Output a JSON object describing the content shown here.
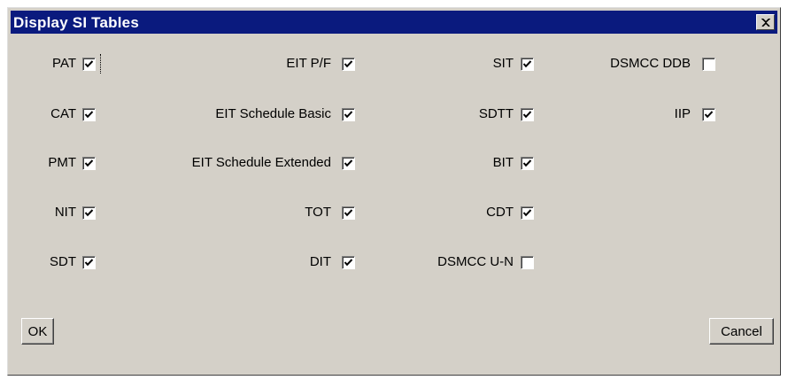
{
  "window": {
    "title": "Display SI Tables",
    "title_bg": "#0a1a7e",
    "face": "#d4d0c8"
  },
  "columns": [
    {
      "items": [
        {
          "label": "PAT",
          "checked": true
        },
        {
          "label": "CAT",
          "checked": true
        },
        {
          "label": "PMT",
          "checked": true
        },
        {
          "label": "NIT",
          "checked": true
        },
        {
          "label": "SDT",
          "checked": true
        }
      ]
    },
    {
      "items": [
        {
          "label": "EIT P/F",
          "checked": true
        },
        {
          "label": "EIT Schedule Basic",
          "checked": true
        },
        {
          "label": "EIT Schedule Extended",
          "checked": true
        },
        {
          "label": "TOT",
          "checked": true
        },
        {
          "label": "DIT",
          "checked": true
        }
      ]
    },
    {
      "items": [
        {
          "label": "SIT",
          "checked": true
        },
        {
          "label": "SDTT",
          "checked": true
        },
        {
          "label": "BIT",
          "checked": true
        },
        {
          "label": "CDT",
          "checked": true
        },
        {
          "label": "DSMCC U-N",
          "checked": false
        }
      ]
    },
    {
      "items": [
        {
          "label": "DSMCC DDB",
          "checked": false
        },
        {
          "label": "IIP",
          "checked": true
        }
      ]
    }
  ],
  "buttons": {
    "ok": "OK",
    "cancel": "Cancel"
  },
  "icons": {
    "close": "close-x-icon",
    "check": "checkmark-icon"
  }
}
